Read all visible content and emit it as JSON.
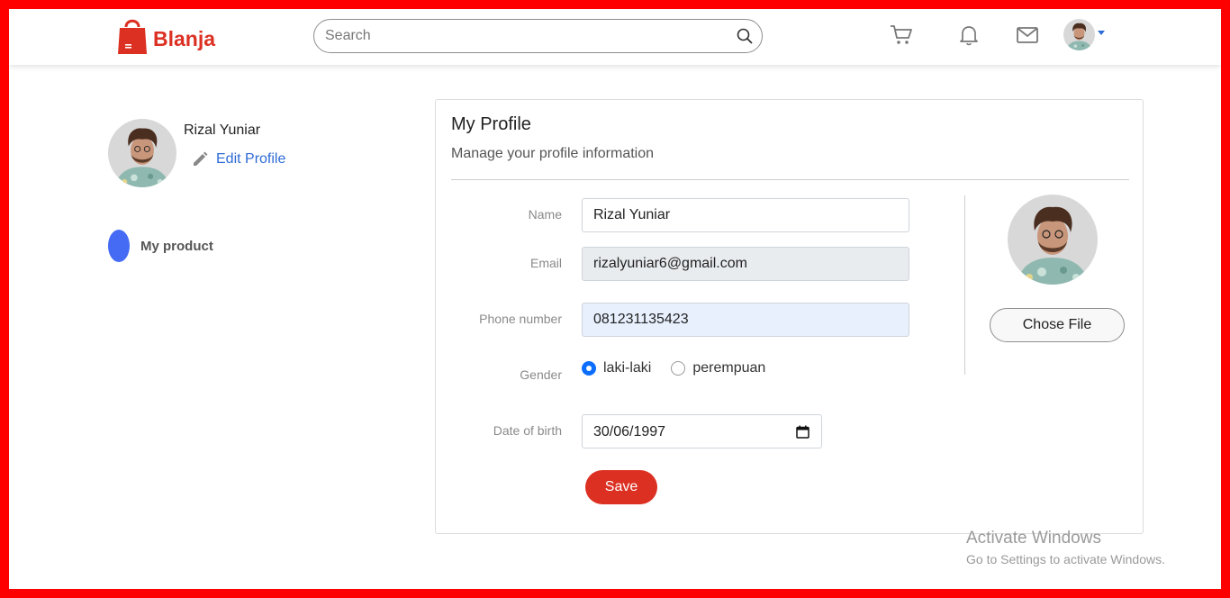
{
  "brand": {
    "name": "Blanja",
    "color": "#db3022"
  },
  "header": {
    "search_placeholder": "Search",
    "icons": [
      "cart-icon",
      "bell-icon",
      "mail-icon",
      "avatar",
      "caret-down-icon"
    ]
  },
  "sidebar": {
    "user_name": "Rizal Yuniar",
    "edit_label": "Edit Profile",
    "menu": [
      {
        "label": "My product",
        "dot_color": "#456bf5"
      }
    ]
  },
  "profile": {
    "title": "My Profile",
    "subtitle": "Manage your profile information",
    "fields": {
      "name": {
        "label": "Name",
        "value": "Rizal Yuniar"
      },
      "email": {
        "label": "Email",
        "value": "rizalyuniar6@gmail.com"
      },
      "phone": {
        "label": "Phone number",
        "value": "081231135423"
      },
      "gender": {
        "label": "Gender",
        "options": [
          "laki-laki",
          "perempuan"
        ],
        "selected": "laki-laki"
      },
      "dob": {
        "label": "Date of birth",
        "value": "30/06/1997"
      }
    },
    "save_label": "Save",
    "choose_file_label": "Chose File"
  },
  "watermark": {
    "title": "Activate Windows",
    "subtitle": "Go to Settings to activate Windows."
  }
}
